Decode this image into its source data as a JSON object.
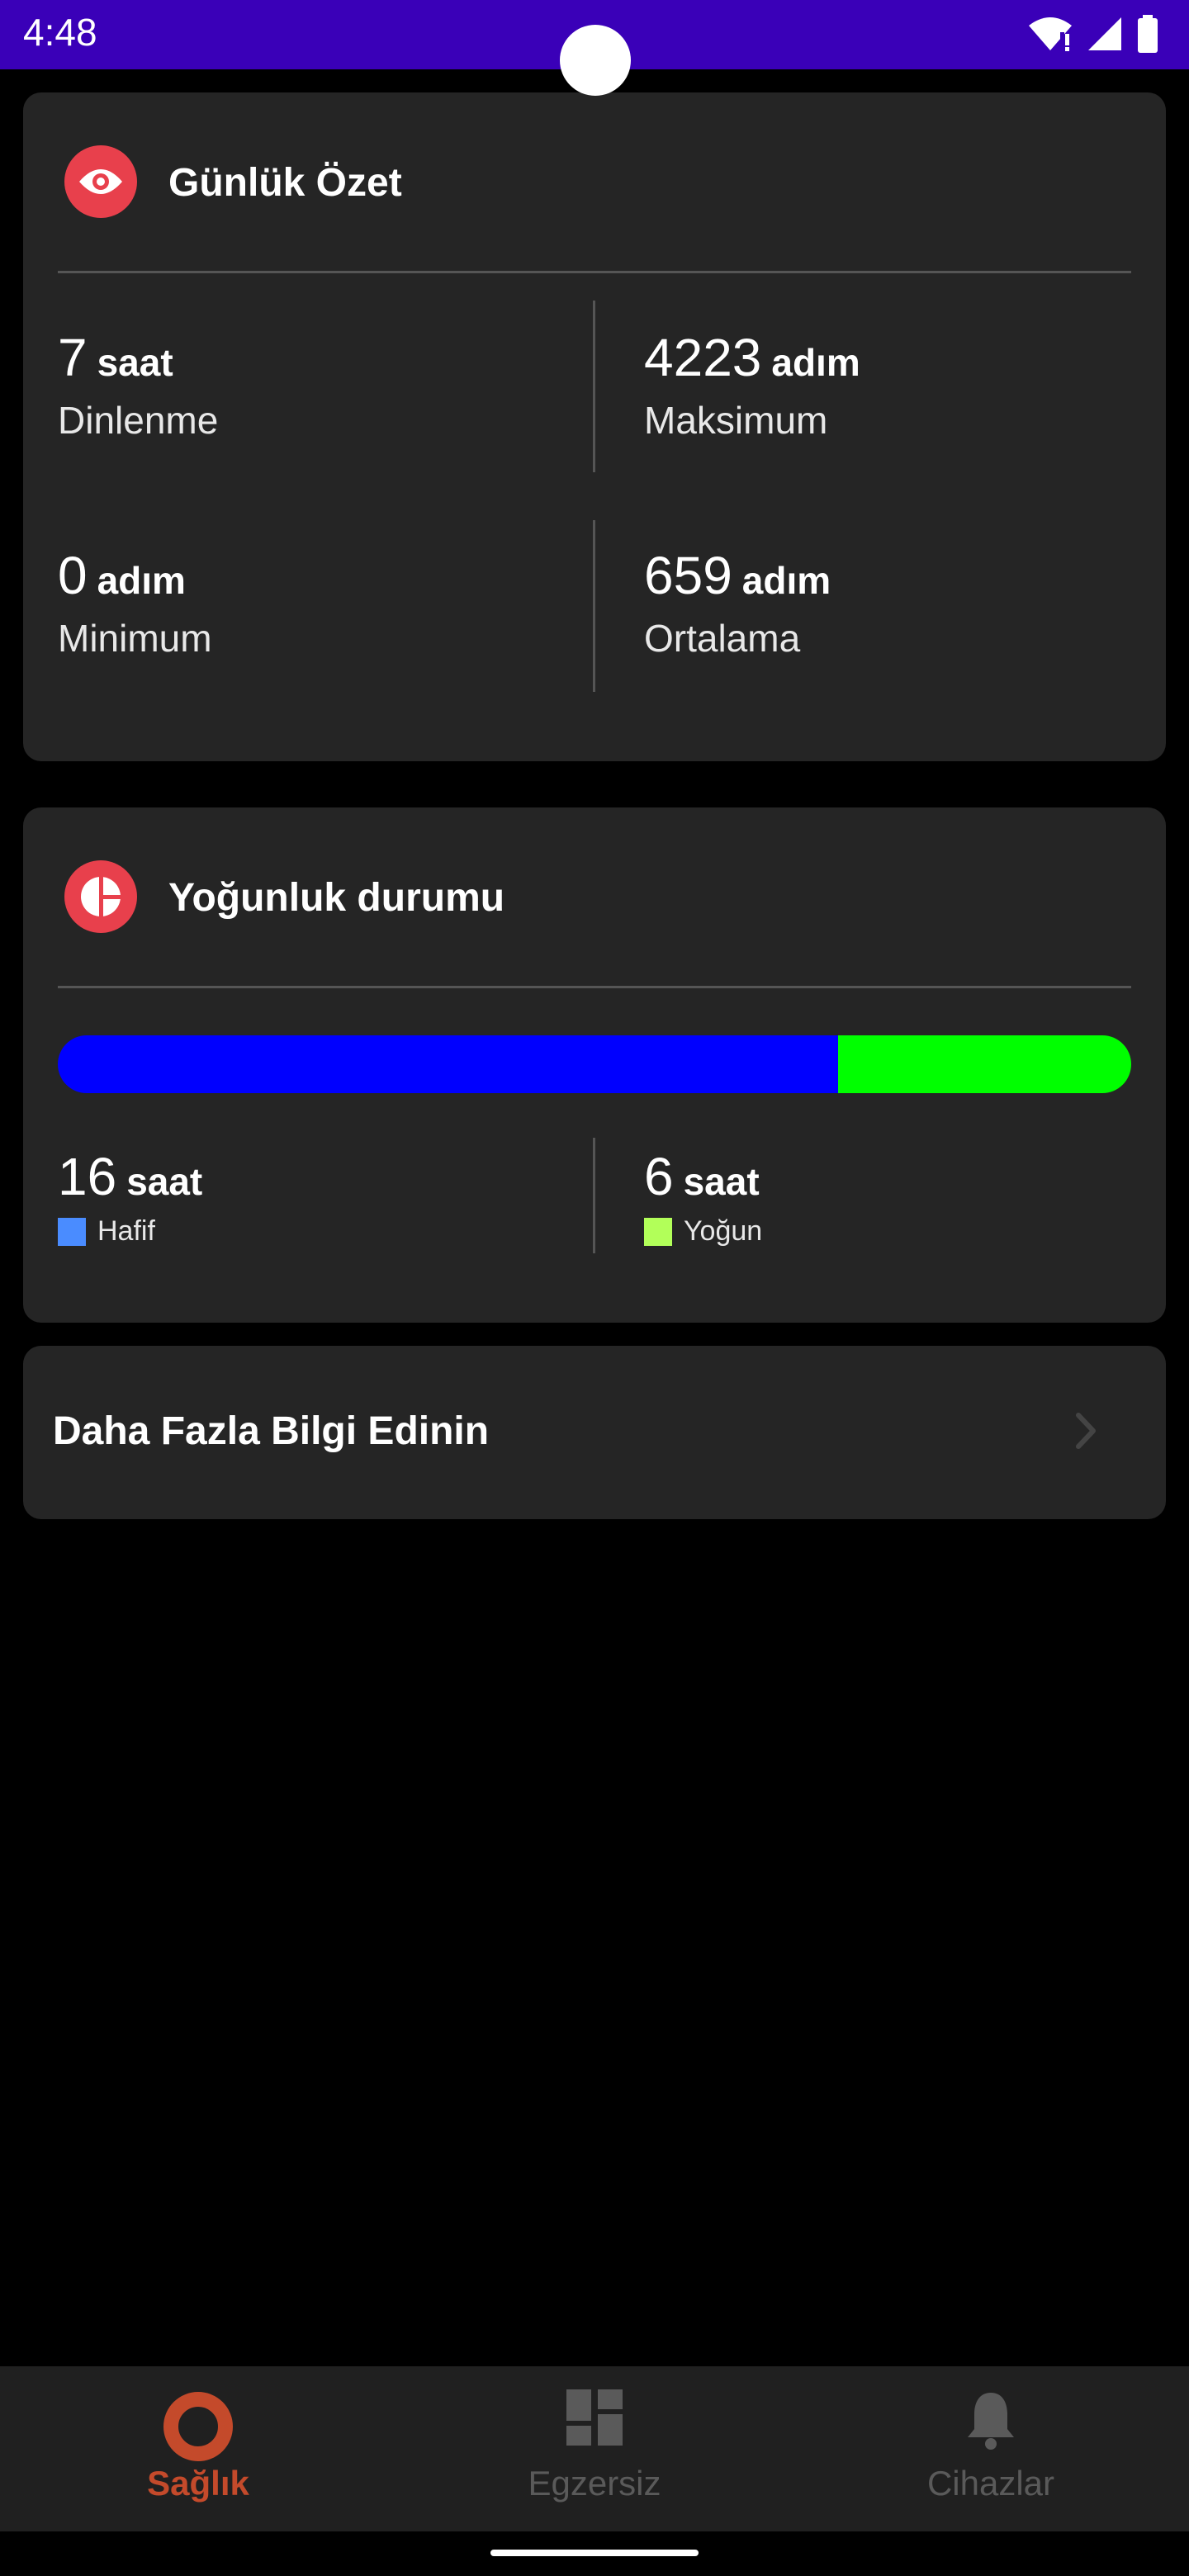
{
  "status_bar": {
    "time": "4:48"
  },
  "daily_summary": {
    "title": "Günlük Özet",
    "icon": "eye-icon",
    "rest": {
      "value": "7",
      "unit": "saat",
      "label": "Dinlenme"
    },
    "max": {
      "value": "4223",
      "unit": "adım",
      "label": "Maksimum"
    },
    "min": {
      "value": "0",
      "unit": "adım",
      "label": "Minimum"
    },
    "avg": {
      "value": "659",
      "unit": "adım",
      "label": "Ortalama"
    }
  },
  "intensity": {
    "title": "Yoğunluk durumu",
    "icon": "pie-chart-icon",
    "light_fraction": 0.7273,
    "light": {
      "value": "16",
      "unit": "saat",
      "label": "Hafif",
      "color": "#0000ff",
      "legend_color": "#4a8cff"
    },
    "intense": {
      "value": "6",
      "unit": "saat",
      "label": "Yoğun",
      "color": "#00ff00",
      "legend_color": "#b2ff59"
    }
  },
  "more_info": {
    "label": "Daha Fazla Bilgi Edinin"
  },
  "bottom_nav": {
    "items": [
      {
        "label": "Sağlık",
        "icon": "health-ring-icon",
        "active": true
      },
      {
        "label": "Egzersiz",
        "icon": "dashboard-icon",
        "active": false
      },
      {
        "label": "Cihazlar",
        "icon": "bell-icon",
        "active": false
      }
    ],
    "active_color": "#c44a2b",
    "inactive_color": "#5a5a5a"
  }
}
